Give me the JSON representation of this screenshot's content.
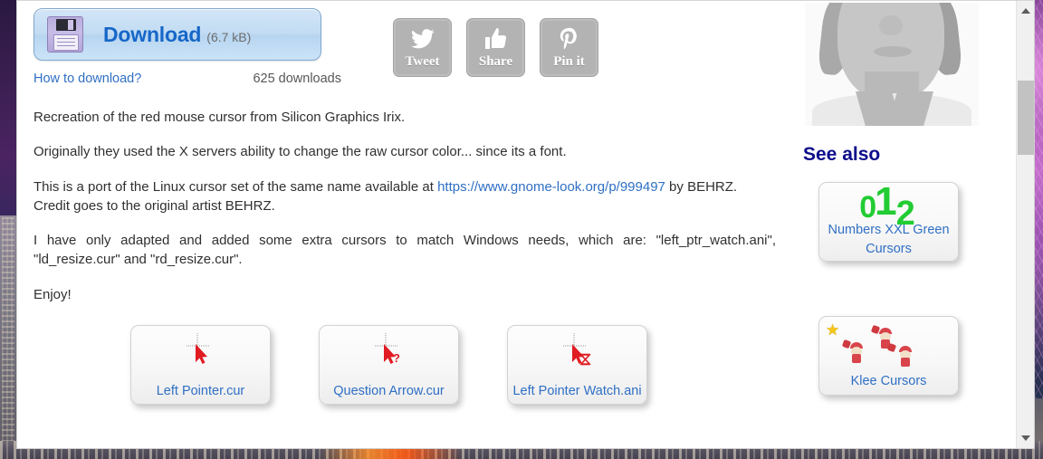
{
  "download": {
    "label": "Download",
    "size": "(6.7 kB)",
    "icon": "floppy-disk-icon",
    "how_to_link": "How to download?",
    "count": "625 downloads"
  },
  "social": [
    {
      "label": "Tweet",
      "icon": "twitter-bird-icon"
    },
    {
      "label": "Share",
      "icon": "thumbs-up-icon"
    },
    {
      "label": "Pin it",
      "icon": "pinterest-icon"
    }
  ],
  "article": {
    "p1": "Recreation of the red mouse cursor from Silicon Graphics Irix.",
    "p2": "Originally they used the X servers ability to change the raw cursor color... since its a font.",
    "p3_before": "This is a port of the Linux cursor set of the same name available at ",
    "p3_link": "https://www.gnome-look.org/p/999497",
    "p3_after": " by BEHRZ. Credit goes to the original artist BEHRZ.",
    "p4": "I have only adapted and added some extra cursors to match Windows needs, which are: \"left_ptr_watch.ani\", \"ld_resize.cur\" and \"rd_resize.cur\".",
    "p5": "Enjoy!"
  },
  "thumbnails": [
    {
      "caption": "Left Pointer.cur",
      "icon": "red-arrow-cursor-icon"
    },
    {
      "caption": "Question Arrow.cur",
      "icon": "red-arrow-question-cursor-icon"
    },
    {
      "caption": "Left Pointer Watch.ani",
      "icon": "red-arrow-hourglass-cursor-icon"
    }
  ],
  "sidebar": {
    "avatar_alt": "user-avatar-illustration",
    "see_also_title": "See also",
    "cards": [
      {
        "caption": "Numbers XXL Green Cursors",
        "art": "green-numbers-012",
        "digits": [
          "0",
          "1",
          "2"
        ]
      },
      {
        "caption": "Klee Cursors",
        "art": "klee-pixel-characters",
        "badge": "star-icon"
      }
    ]
  },
  "scrollbar": {
    "up_icon": "scroll-up-arrow-icon",
    "down_icon": "scroll-down-arrow-icon",
    "thumb": "scrollbar-thumb"
  },
  "colors": {
    "link": "#2f6fc4",
    "download_blue": "#1667c8",
    "see_also_navy": "#0d0d8c",
    "cursor_red": "#e11b22",
    "numbers_green": "#22cc33",
    "social_gray": "#b3b3b3"
  }
}
